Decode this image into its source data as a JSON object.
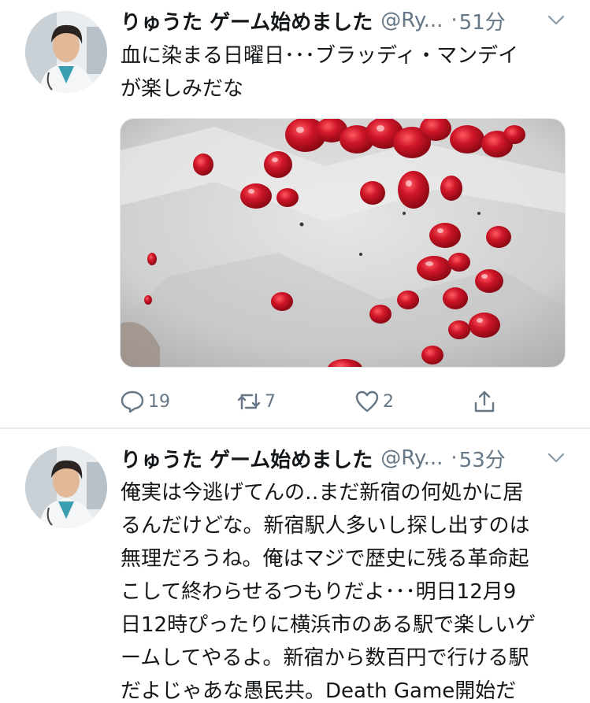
{
  "tweets": [
    {
      "display_name": "りゅうた ゲーム始めました",
      "handle": "@Ry...",
      "separator": "·",
      "time": "51分",
      "text_lines": [
        "血に染まる日曜日･･･ブラッディ・マンデイ",
        "が楽しみだな"
      ],
      "replies": "19",
      "retweets": "7",
      "likes": "2",
      "icons": {
        "reply": "reply-icon",
        "retweet": "retweet-icon",
        "like": "heart-icon",
        "share": "share-icon",
        "menu": "chevron-down-icon"
      }
    },
    {
      "display_name": "りゅうた ゲーム始めました",
      "handle": "@Ry...",
      "separator": "·",
      "time": "53分",
      "text_lines": [
        "俺実は今逃げてんの‥まだ新宿の何処かに居",
        "るんだけどな。新宿駅人多いし探し出すのは",
        "無理だろうね。俺はマジで歴史に残る革命起",
        "こして終わらせるつもりだよ･･･明日12月9",
        "日12時ぴったりに横浜市のある駅で楽しいゲ",
        "ームしてやるよ。新宿から数百円で行ける駅",
        "だよじゃあな愚民共。Death Game開始だ"
      ]
    }
  ],
  "colors": {
    "text": "#14171a",
    "secondary": "#657786",
    "divider": "#e6ecf0",
    "blood": "#c41425"
  }
}
